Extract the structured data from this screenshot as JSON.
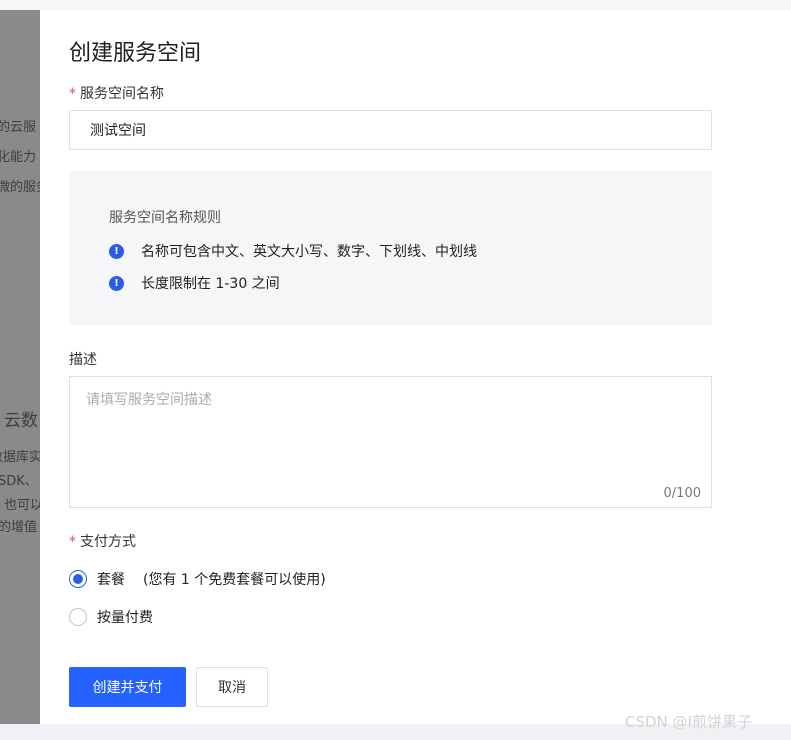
{
  "background": {
    "lines": [
      "的云服",
      "化能力",
      "微的服务",
      "云数",
      "数据库实",
      "SDK、",
      "也可以",
      "的增值"
    ]
  },
  "modal": {
    "title": "创建服务空间",
    "name_field": {
      "required_mark": "*",
      "label": "服务空间名称",
      "value": "测试空间"
    },
    "rules": {
      "title": "服务空间名称规则",
      "items": [
        "名称可包含中文、英文大小写、数字、下划线、中划线",
        "长度限制在 1-30 之间"
      ]
    },
    "description": {
      "label": "描述",
      "placeholder": "请填写服务空间描述",
      "counter": "0/100"
    },
    "payment": {
      "required_mark": "*",
      "label": "支付方式",
      "options": [
        {
          "label": "套餐",
          "hint": "(您有 1 个免费套餐可以使用)",
          "selected": true
        },
        {
          "label": "按量付费",
          "hint": "",
          "selected": false
        }
      ]
    },
    "buttons": {
      "submit": "创建并支付",
      "cancel": "取消"
    }
  },
  "watermark": "CSDN @I煎饼果子",
  "colors": {
    "primary": "#2461ff",
    "required": "#e34d59",
    "overlay": "#8a8a8a",
    "rules_bg": "#f5f6f8"
  }
}
